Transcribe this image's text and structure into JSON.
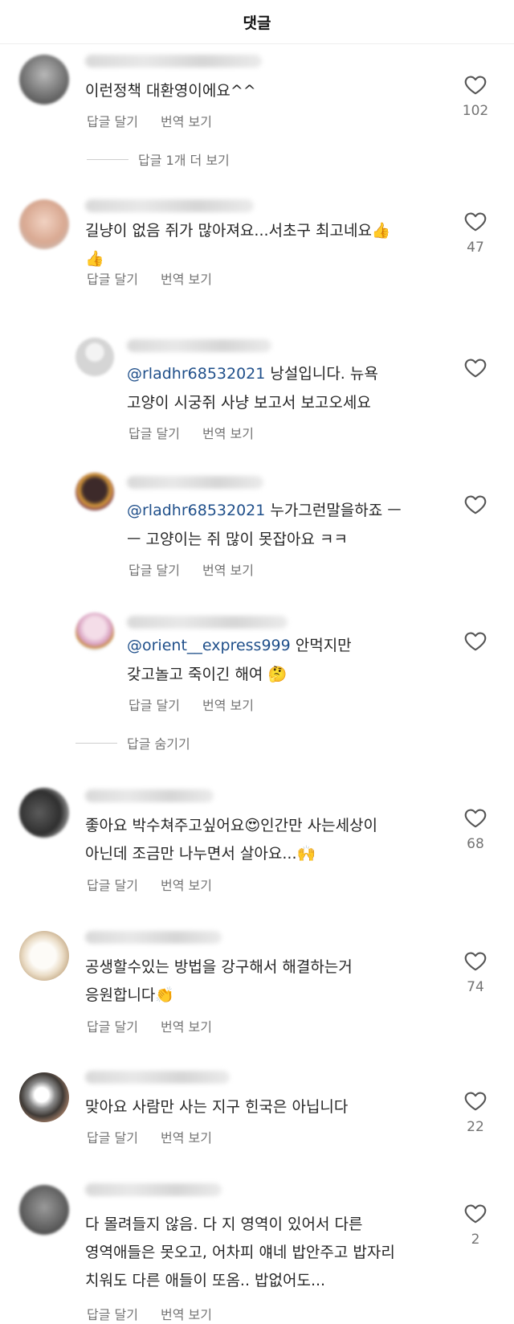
{
  "header": {
    "title": "댓글"
  },
  "labels": {
    "reply": "답글 달기",
    "translate": "번역 보기"
  },
  "comments": [
    {
      "text": "이런정책 대환영이에요^^",
      "likes": "102",
      "more_replies": "답글 1개 더 보기"
    },
    {
      "text_line1": "길냥이 없음 쥐가 많아져요...서초구 최고네요👍",
      "text_line2": "👍",
      "likes": "47"
    },
    {
      "mention": "@rladhr68532021",
      "text_line1": " 낭설입니다. 뉴욕",
      "text_line2": "고양이 시궁쥐 사냥 보고서 보고오세요"
    },
    {
      "mention": "@rladhr68532021",
      "text_line1": " 누가그런말을하죠 ㅡ",
      "text_line2": "ㅡ 고양이는 쥐 많이 못잡아요 ㅋㅋ"
    },
    {
      "mention": "@orient__express999",
      "text_line1": " 안먹지만",
      "text_line2": "갖고놀고 죽이긴 해여 🤔",
      "hide_replies": "답글 숨기기"
    },
    {
      "text_line1": "좋아요 박수쳐주고싶어요😍인간만 사는세상이",
      "text_line2": "아닌데 조금만 나누면서 살아요...🙌",
      "likes": "68"
    },
    {
      "text_line1": "공생할수있는 방법을 강구해서 해결하는거",
      "text_line2": "응원합니다👏",
      "likes": "74"
    },
    {
      "text": "맞아요 사람만 사는 지구 힌국은 아닙니다",
      "likes": "22"
    },
    {
      "text_line1": "다 몰려들지 않음. 다 지 영역이 있어서 다른",
      "text_line2": "영역애들은 못오고, 어차피 얘네 밥안주고 밥자리",
      "text_line3": "치워도 다른 애들이 또옴.. 밥없어도...",
      "likes": "2"
    }
  ]
}
